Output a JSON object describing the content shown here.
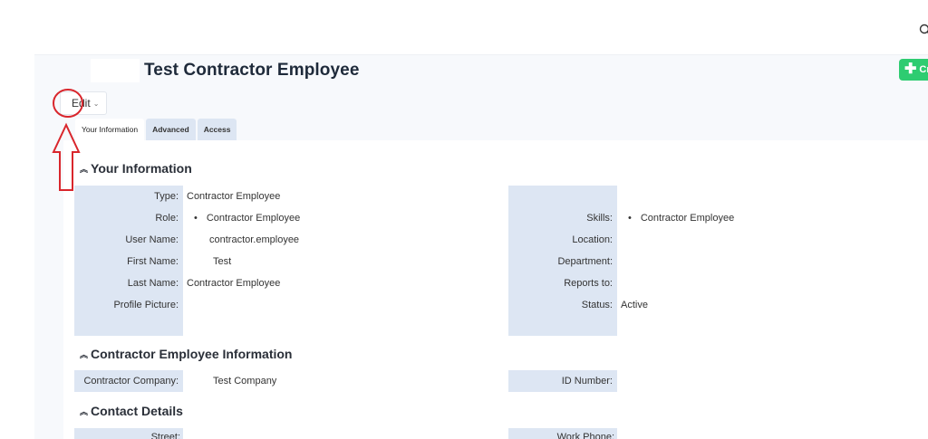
{
  "page": {
    "title": "Test Contractor Employee",
    "create_label": "Cr",
    "edit_label": "Edit",
    "tabs": [
      {
        "label": "Your Information",
        "active": true
      },
      {
        "label": "Advanced",
        "active": false
      },
      {
        "label": "Access",
        "active": false
      }
    ]
  },
  "your_information": {
    "title": "Your Information",
    "left": [
      {
        "label": "Type:",
        "value": "Contractor Employee"
      },
      {
        "label": "Role:",
        "value": "Contractor Employee"
      },
      {
        "label": "User Name:",
        "value": "contractor.employee"
      },
      {
        "label": "First Name:",
        "value": "Test"
      },
      {
        "label": "Last Name:",
        "value": "Contractor Employee"
      },
      {
        "label": "Profile Picture:",
        "value": ""
      }
    ],
    "right": [
      {
        "label": "Skills:",
        "value": "Contractor Employee"
      },
      {
        "label": "Location:",
        "value": ""
      },
      {
        "label": "Department:",
        "value": ""
      },
      {
        "label": "Reports to:",
        "value": ""
      },
      {
        "label": "Status:",
        "value": "Active"
      }
    ]
  },
  "contractor_info": {
    "title": "Contractor Employee Information",
    "left": [
      {
        "label": "Contractor Company:",
        "value": "Test Company"
      }
    ],
    "right": [
      {
        "label": "ID Number:",
        "value": ""
      }
    ]
  },
  "contact_details": {
    "title": "Contact Details",
    "left": [
      {
        "label": "Street:",
        "value": ""
      }
    ],
    "right": [
      {
        "label": "Work Phone:",
        "value": ""
      }
    ]
  },
  "colors": {
    "accent_green": "#2ecc71",
    "label_bg": "#dde6f3",
    "annotation_red": "#d9262c"
  },
  "icons": {
    "search": "search-icon",
    "plus": "plus-icon",
    "caret": "chevron-down-icon",
    "collapse": "chevron-up-icon"
  }
}
